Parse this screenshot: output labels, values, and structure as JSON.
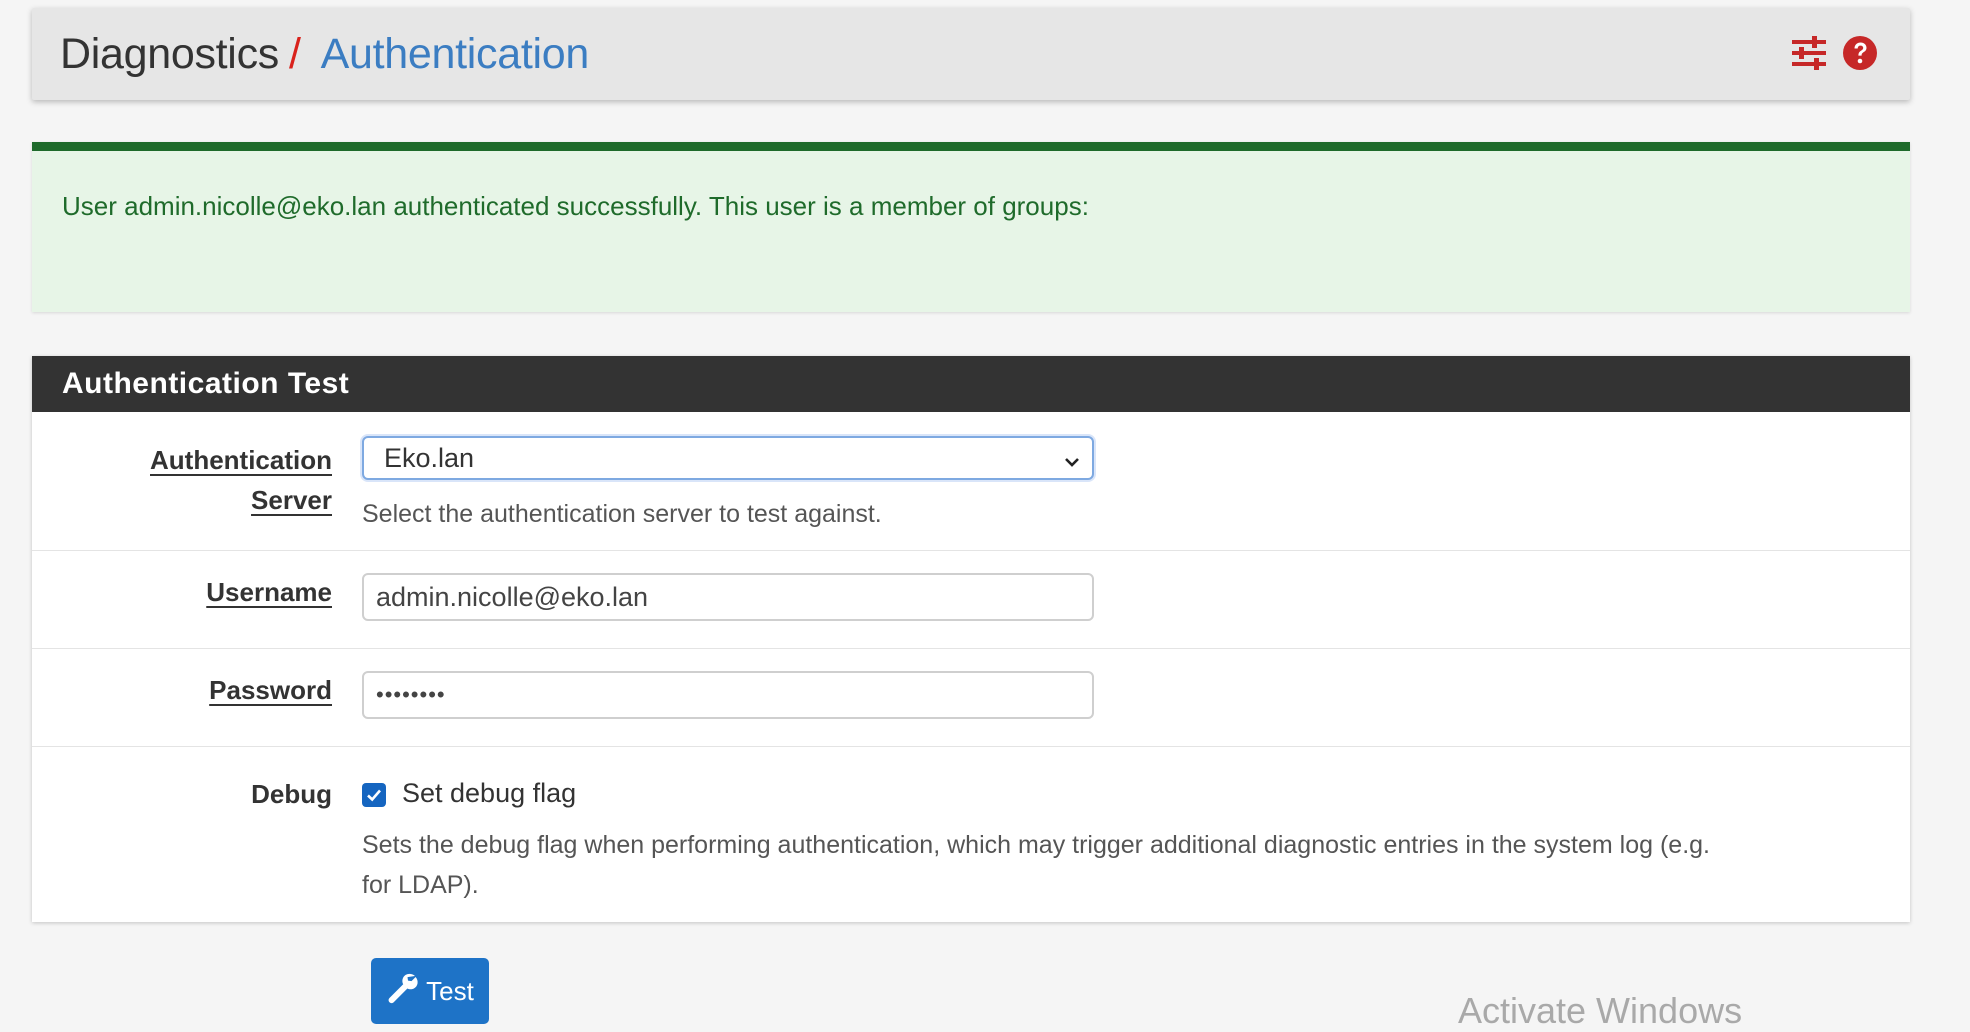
{
  "breadcrumb": {
    "parent": "Diagnostics",
    "separator": "/",
    "current": "Authentication"
  },
  "header_icons": [
    "sliders-icon",
    "help-icon"
  ],
  "alert": {
    "message": "User admin.nicolle@eko.lan authenticated successfully. This user is a member of groups:"
  },
  "panel": {
    "title": "Authentication Test",
    "auth_server": {
      "label_line1": "Authentication",
      "label_line2": "Server",
      "selected": "Eko.lan",
      "help": "Select the authentication server to test against."
    },
    "username": {
      "label": "Username",
      "value": "admin.nicolle@eko.lan"
    },
    "password": {
      "label": "Password",
      "value": "••••••••"
    },
    "debug": {
      "label": "Debug",
      "checkbox_label": "Set debug flag",
      "checked": true,
      "help_line1": "Sets the debug flag when performing authentication, which may trigger additional diagnostic entries in the system log (e.g.",
      "help_line2": "for LDAP)."
    }
  },
  "actions": {
    "test_label": "Test"
  },
  "watermark": "Activate Windows",
  "colors": {
    "accent": "#3b7dc2",
    "separator": "#d9221c",
    "success_border": "#1e6a2b",
    "success_bg": "#e7f5e7",
    "panel_header": "#333333",
    "button": "#1e73c7",
    "icon_red": "#c62828"
  }
}
